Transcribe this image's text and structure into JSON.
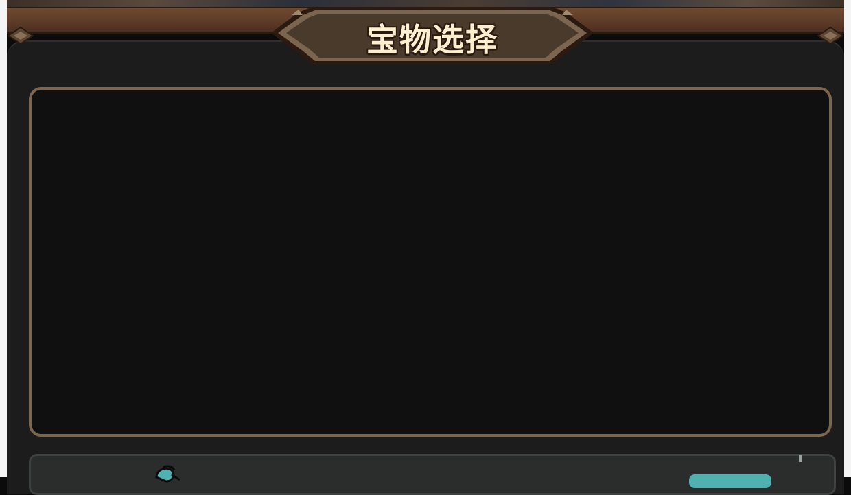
{
  "title": "宝物选择",
  "colors": {
    "panel_bg": "#1c1c1c",
    "display_bg": "#101010",
    "display_border": "#7b6650",
    "title_text": "#fbefcf",
    "title_plaque": "#4a3a2c",
    "accent_teal": "#4fb1b0"
  },
  "icons": {
    "card_icon": "scroll-icon"
  }
}
